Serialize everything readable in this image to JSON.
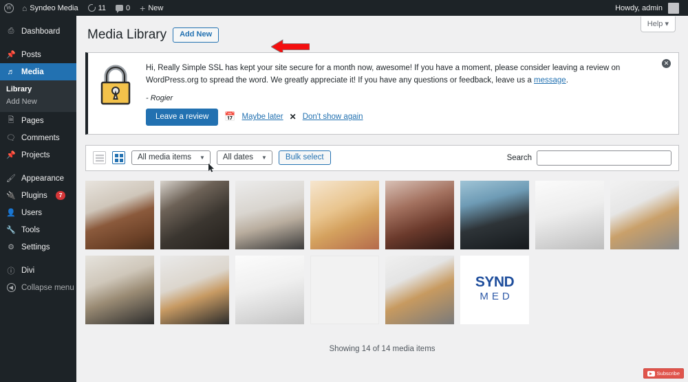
{
  "adminbar": {
    "logo_icon": "wordpress-logo-icon",
    "site_name": "Syndeo Media",
    "home_icon": "home-icon",
    "updates_icon": "updates-icon",
    "updates_count": "11",
    "comments_icon": "comments-icon",
    "comments_count": "0",
    "new_icon": "plus-icon",
    "new_label": "New",
    "howdy": "Howdy, admin",
    "avatar": "user-avatar"
  },
  "sidebar": {
    "items": [
      {
        "label": "Dashboard",
        "icon": "dashboard-icon",
        "name": "dashboard"
      },
      {
        "label": "Posts",
        "icon": "pin-icon",
        "name": "posts"
      },
      {
        "label": "Media",
        "icon": "media-icon",
        "name": "media",
        "current": true
      },
      {
        "label": "Pages",
        "icon": "page-icon",
        "name": "pages"
      },
      {
        "label": "Comments",
        "icon": "comment-icon",
        "name": "comments"
      },
      {
        "label": "Projects",
        "icon": "pin-icon",
        "name": "projects"
      },
      {
        "label": "Appearance",
        "icon": "brush-icon",
        "name": "appearance"
      },
      {
        "label": "Plugins",
        "icon": "plug-icon",
        "name": "plugins",
        "badge": "7"
      },
      {
        "label": "Users",
        "icon": "user-icon",
        "name": "users"
      },
      {
        "label": "Tools",
        "icon": "wrench-icon",
        "name": "tools"
      },
      {
        "label": "Settings",
        "icon": "sliders-icon",
        "name": "settings"
      },
      {
        "label": "Divi",
        "icon": "divi-icon",
        "name": "divi"
      },
      {
        "label": "Collapse menu",
        "icon": "collapse-icon",
        "name": "collapse-menu"
      }
    ],
    "submenu": [
      {
        "label": "Library",
        "active": true
      },
      {
        "label": "Add New",
        "active": false
      }
    ]
  },
  "help_tab": {
    "label": "Help",
    "caret": "chevron-down-icon"
  },
  "page": {
    "title": "Media Library",
    "add_new_label": "Add New",
    "annotation_arrow": "red-arrow-left-icon"
  },
  "notice": {
    "lock_icon": "padlock-icon",
    "text_part1": "Hi, Really Simple SSL has kept your site secure for a month now, awesome! If you have a moment, please consider leaving a review on WordPress.org to spread the word. We greatly appreciate it! If you have any questions or feedback, leave us a ",
    "link_label": "message",
    "text_part2": ".",
    "signature": "- Rogier",
    "primary_button": "Leave a review",
    "calendar_icon": "calendar-icon",
    "maybe_later": "Maybe later",
    "close_icon": "x-icon",
    "dont_show_again": "Don't show again",
    "dismiss_icon": "dismiss-circle-icon",
    "accent_color": "#2271b1"
  },
  "toolbar": {
    "list_view_icon": "list-view-icon",
    "grid_view_icon": "grid-view-icon",
    "media_filter_value": "All media items",
    "date_filter_value": "All dates",
    "bulk_select_label": "Bulk select",
    "search_label": "Search",
    "search_value": "",
    "search_placeholder": "",
    "caret_icon": "chevron-down-icon"
  },
  "media_items": [
    {
      "name": "leather-backpack",
      "style": "ph-backpack"
    },
    {
      "name": "desk-plants",
      "style": "ph-plants"
    },
    {
      "name": "glasses-on-book",
      "style": "ph-glasses1"
    },
    {
      "name": "person-with-camera",
      "style": "ph-camera"
    },
    {
      "name": "woman-portrait",
      "style": "ph-woman"
    },
    {
      "name": "man-smiling-mountains",
      "style": "ph-man"
    },
    {
      "name": "laptop-desk",
      "style": "ph-laptop"
    },
    {
      "name": "headphones-phone",
      "style": "ph-head1"
    },
    {
      "name": "glasses-notebook",
      "style": "ph-glasses2"
    },
    {
      "name": "phone-on-desk",
      "style": "ph-phone"
    },
    {
      "name": "laptop-keyboard",
      "style": "ph-laptop2"
    },
    {
      "name": "blank-placeholder",
      "style": "ph-blank"
    },
    {
      "name": "headphones-phone-flatlay",
      "style": "ph-head2"
    },
    {
      "name": "syndmed-logo",
      "style": "ph-logo",
      "logo_top": "SYND",
      "logo_bottom": "MED"
    }
  ],
  "footer": {
    "count_text": "Showing 14 of 14 media items"
  },
  "youtube_widget": {
    "play_icon": "youtube-play-icon",
    "label": "Subscribe"
  },
  "cursor": {
    "icon": "mouse-cursor-icon"
  }
}
